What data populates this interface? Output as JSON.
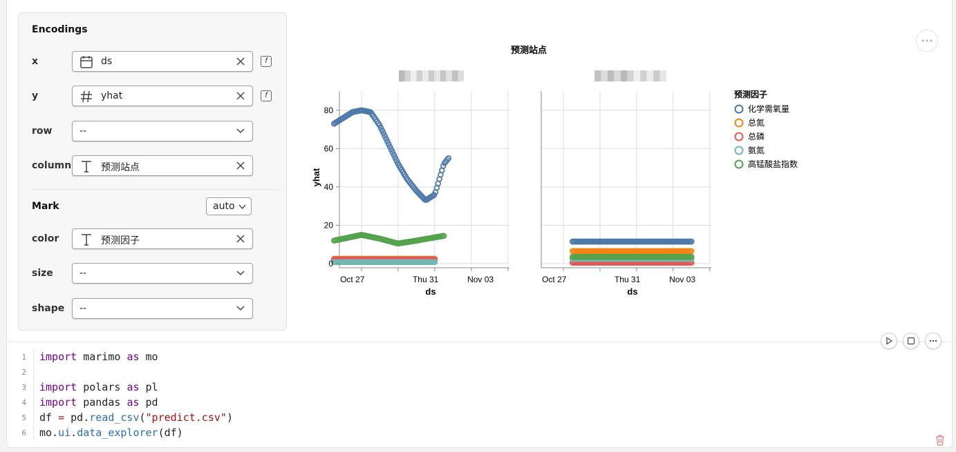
{
  "encodings": {
    "title": "Encodings",
    "x": {
      "label": "x",
      "value": "ds",
      "icon": "calendar-icon"
    },
    "y": {
      "label": "y",
      "value": "yhat",
      "icon": "hash-icon"
    },
    "row": {
      "label": "row",
      "value": "--"
    },
    "column": {
      "label": "column",
      "value": "预测站点",
      "icon": "text-type-icon"
    },
    "mark_label": "Mark",
    "mark_value": "auto",
    "color": {
      "label": "color",
      "value": "预测因子",
      "icon": "text-type-icon"
    },
    "size": {
      "label": "size",
      "value": "--"
    },
    "shape": {
      "label": "shape",
      "value": "--"
    }
  },
  "chart": {
    "title": "预测站点",
    "xlabel": "ds",
    "ylabel": "yhat",
    "yticks": [
      "0",
      "20",
      "40",
      "60",
      "80"
    ],
    "xticks": [
      "Oct 27",
      "Thu 31",
      "Nov 03"
    ],
    "legend_title": "预测因子",
    "legend": [
      {
        "label": "化学需氧量",
        "color": "#4c78a8"
      },
      {
        "label": "总氮",
        "color": "#f58518"
      },
      {
        "label": "总磷",
        "color": "#e45756"
      },
      {
        "label": "氨氮",
        "color": "#72b7b2"
      },
      {
        "label": "高锰酸盐指数",
        "color": "#54a24b"
      }
    ]
  },
  "chart_data": {
    "type": "scatter",
    "title": "预测站点",
    "xlabel": "ds",
    "ylabel": "yhat",
    "ylim": [
      0,
      90
    ],
    "xlim": [
      "2024-10-26",
      "2024-11-03"
    ],
    "grid": true,
    "legend_position": "right",
    "facets": [
      {
        "series": [
          {
            "name": "化学需氧量",
            "x": [
              "10-26 00:00",
              "10-26 12:00",
              "10-27 00:00",
              "10-27 12:00",
              "10-28 00:00",
              "10-28 12:00",
              "10-29 00:00",
              "10-29 12:00",
              "10-30 00:00",
              "10-30 12:00",
              "10-31 00:00",
              "10-31 12:00",
              "11-01 00:00",
              "11-01 06:00"
            ],
            "y": [
              73,
              76,
              79,
              80,
              79,
              72,
              62,
              52,
              44,
              38,
              33,
              36,
              52,
              55
            ]
          },
          {
            "name": "总氮",
            "x": [
              "10-26 00:00",
              "10-31 12:00"
            ],
            "y": [
              2.5,
              2.5
            ]
          },
          {
            "name": "总磷",
            "x": [
              "10-26 00:00",
              "10-31 12:00"
            ],
            "y": [
              2.2,
              2.2
            ]
          },
          {
            "name": "氨氮",
            "x": [
              "10-26 00:00",
              "10-31 12:00"
            ],
            "y": [
              0.8,
              0.8
            ]
          },
          {
            "name": "高锰酸盐指数",
            "x": [
              "10-26 00:00",
              "10-27 12:00",
              "10-28 12:00",
              "10-29 12:00",
              "10-30 12:00",
              "11-01 00:00"
            ],
            "y": [
              12,
              15,
              13,
              10.5,
              12,
              14.5
            ]
          }
        ]
      },
      {
        "series": [
          {
            "name": "化学需氧量",
            "x": [
              "10-28 00:00",
              "11-03 12:00"
            ],
            "y": [
              11.5,
              11.5
            ]
          },
          {
            "name": "总氮",
            "x": [
              "10-28 00:00",
              "11-03 12:00"
            ],
            "y": [
              6.5,
              6.5
            ]
          },
          {
            "name": "总磷",
            "x": [
              "10-28 00:00",
              "11-03 12:00"
            ],
            "y": [
              0.5,
              0.5
            ]
          },
          {
            "name": "氨氮",
            "x": [
              "10-28 00:00",
              "11-03 12:00"
            ],
            "y": [
              2.5,
              2.5
            ]
          },
          {
            "name": "高锰酸盐指数",
            "x": [
              "10-28 00:00",
              "11-03 12:00"
            ],
            "y": [
              3.5,
              3.5
            ]
          }
        ]
      }
    ]
  },
  "code": {
    "lines": [
      {
        "n": "1"
      },
      {
        "n": "2"
      },
      {
        "n": "3"
      },
      {
        "n": "4"
      },
      {
        "n": "5"
      },
      {
        "n": "6"
      }
    ]
  }
}
